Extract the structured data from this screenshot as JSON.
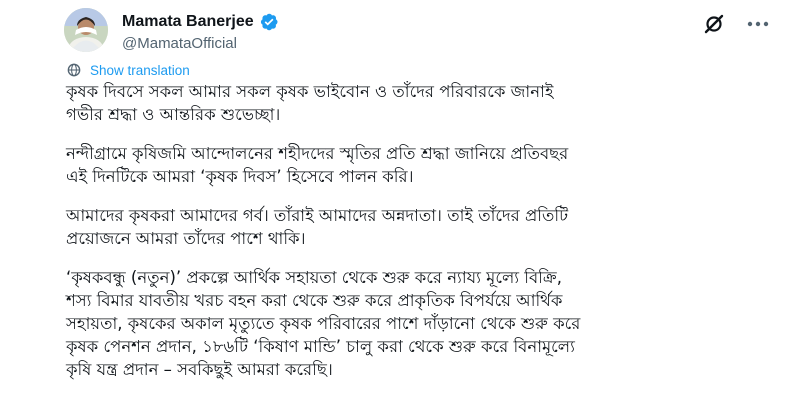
{
  "author": {
    "name": "Mamata Banerjee",
    "handle": "@MamataOfficial",
    "verified": true,
    "verified_color": "#1d9bf0"
  },
  "actions": {
    "grok_icon": "grok-slash-icon",
    "more_icon": "more-horizontal-icon"
  },
  "translation": {
    "label": "Show translation",
    "icon": "globe-icon",
    "color": "#1d9bf0"
  },
  "tweet": {
    "paragraphs": [
      "কৃষক দিবসে সকল আমার সকল কৃষক ভাইবোন ও তাঁদের পরিবারকে জানাই\nগভীর শ্রদ্ধা ও আন্তরিক শুভেচ্ছা।",
      "নন্দীগ্রামে কৃষিজমি আন্দোলনের শহীদদের স্মৃতির প্রতি শ্রদ্ধা জানিয়ে প্রতিবছর\nএই দিনটিকে আমরা ‘কৃষক দিবস’ হিসেবে পালন করি।",
      "আমাদের কৃষকরা আমাদের গর্ব। তাঁরাই আমাদের অন্নদাতা। তাই তাঁদের প্রতিটি\nপ্রয়োজনে আমরা তাঁদের পাশে থাকি।",
      "‘কৃষকবন্ধু (নতুন)’ প্রকল্পে আর্থিক সহায়তা থেকে শুরু করে ন্যায্য মূল্যে বিক্রি,\nশস্য বিমার যাবতীয় খরচ বহন করা থেকে শুরু করে প্রাকৃতিক বিপর্যয়ে আর্থিক\nসহায়তা, কৃষকের অকাল মৃত্যুতে কৃষক পরিবারের পাশে দাঁড়ানো থেকে শুরু করে\nকৃষক পেনশন প্রদান, ১৮৬টি ‘কিষাণ মান্ডি’ চালু করা থেকে শুরু করে বিনামূল্যে\nকৃষি যন্ত্র প্রদান – সবকিছুই আমরা করেছি।"
    ]
  }
}
